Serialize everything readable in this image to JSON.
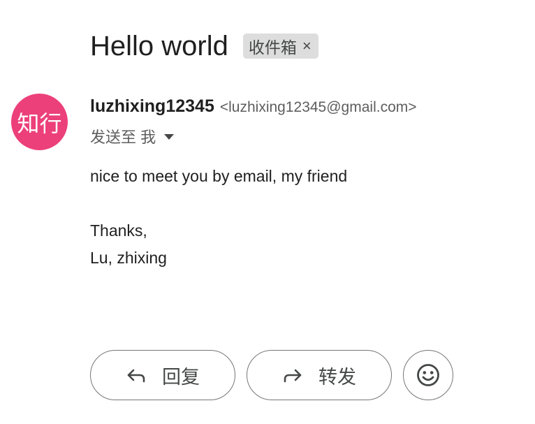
{
  "email": {
    "subject": "Hello world",
    "label": {
      "name": "收件箱",
      "remove_glyph": "×"
    },
    "sender": {
      "avatar_text": "知行",
      "avatar_color": "#ec407a",
      "name": "luzhixing12345",
      "email": "<luzhixing12345@gmail.com>"
    },
    "recipients_summary": "发送至 我",
    "body": {
      "line1": "nice to meet you by email, my friend",
      "line2": "Thanks,",
      "line3": "Lu, zhixing"
    }
  },
  "actions": {
    "reply_label": "回复",
    "reply_icon": "reply-icon",
    "forward_label": "转发",
    "forward_icon": "forward-icon",
    "emoji_icon": "emoji-smile-icon"
  }
}
